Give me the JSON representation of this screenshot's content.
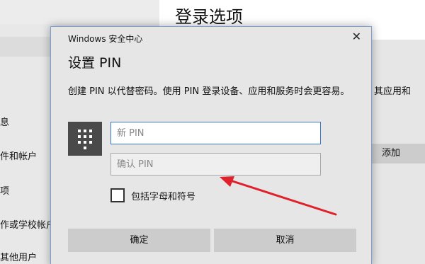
{
  "background": {
    "title": "登录选项",
    "nav_items": [
      "息",
      "件和帐户",
      "项",
      "作或学校帐户",
      "其他用户"
    ],
    "right_text": "其应用和",
    "add_button": "添加"
  },
  "dialog": {
    "app_name": "Windows 安全中心",
    "close_glyph": "✕",
    "title": "设置 PIN",
    "description": "创建 PIN 以代替密码。使用 PIN 登录设备、应用和服务时会更容易。",
    "new_pin_placeholder": "新 PIN",
    "confirm_pin_placeholder": "确认 PIN",
    "checkbox_label": "包括字母和符号",
    "ok_label": "确定",
    "cancel_label": "取消"
  },
  "colors": {
    "accent": "#3a78c9",
    "annotation_arrow": "#e0202a"
  },
  "icons": [
    "keypad-icon",
    "close-icon",
    "arrow-annotation"
  ]
}
